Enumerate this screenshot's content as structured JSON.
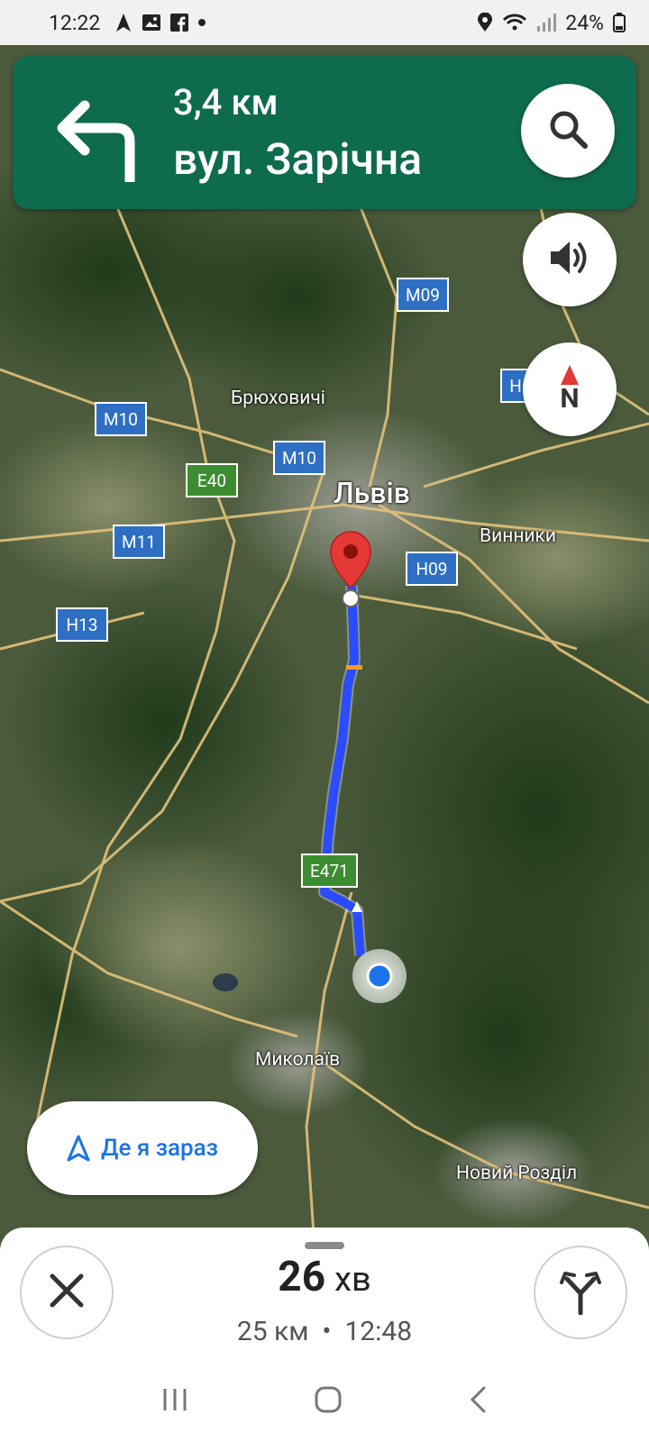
{
  "status_bar": {
    "time": "12:22",
    "battery": "24%",
    "left_icons": [
      "navigation-arrow-icon",
      "image-icon",
      "facebook-icon",
      "dot-icon"
    ],
    "right_icons": [
      "location-pin-icon",
      "wifi-icon",
      "signal-icon",
      "battery-icon"
    ]
  },
  "navigation": {
    "distance": "3,4 км",
    "street": "вул. Зарічна",
    "turn_icon": "turn-left-icon"
  },
  "map_buttons": [
    "search-icon",
    "volume-icon",
    "compass-icon"
  ],
  "compass_letter": "N",
  "map_labels": {
    "lviv": "Львів",
    "briukhovychi": "Брюховичі",
    "vynnyky": "Винники",
    "mykolaiv": "Миколаїв",
    "novyi_rozdil": "Новий Розділ"
  },
  "road_shields": {
    "m09": "M09",
    "m10a": "M10",
    "m10b": "M10",
    "e40": "E40",
    "m11": "M11",
    "h09": "H09",
    "h13": "H13",
    "e471": "E471",
    "h_partial": "H"
  },
  "where_am_i": "Де я зараз",
  "trip": {
    "minutes": "26",
    "minutes_unit": "хв",
    "summary": "25 км  •  12:48"
  },
  "colors": {
    "banner": "#0f6b4e",
    "route": "#2a4bff",
    "accent": "#1a73e8"
  }
}
